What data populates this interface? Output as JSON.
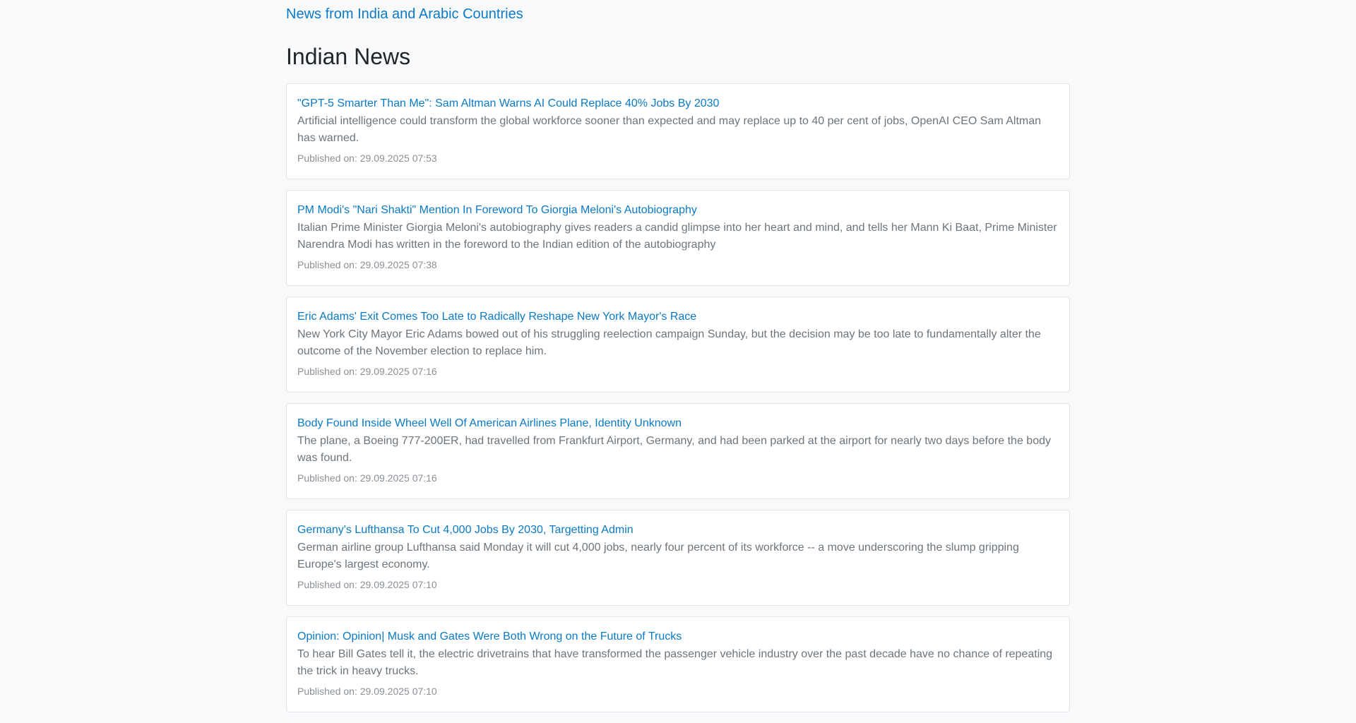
{
  "header": {
    "site_link": "News from India and Arabic Countries",
    "heading": "Indian News"
  },
  "articles": [
    {
      "title": "\"GPT-5 Smarter Than Me\": Sam Altman Warns AI Could Replace 40% Jobs By 2030",
      "description": "Artificial intelligence could transform the global workforce sooner than expected and may replace up to 40 per cent of jobs, OpenAI CEO Sam Altman has warned.",
      "published": "Published on: 29.09.2025 07:53"
    },
    {
      "title": "PM Modi's \"Nari Shakti\" Mention In Foreword To Giorgia Meloni's Autobiography",
      "description": "Italian Prime Minister Giorgia Meloni's autobiography gives readers a candid glimpse into her heart and mind, and tells her Mann Ki Baat, Prime Minister Narendra Modi has written in the foreword to the Indian edition of the autobiography",
      "published": "Published on: 29.09.2025 07:38"
    },
    {
      "title": "Eric Adams' Exit Comes Too Late to Radically Reshape New York Mayor's Race",
      "description": "New York City Mayor Eric Adams bowed out of his struggling reelection campaign Sunday, but the decision may be too late to fundamentally alter the outcome of the November election to replace him.",
      "published": "Published on: 29.09.2025 07:16"
    },
    {
      "title": "Body Found Inside Wheel Well Of American Airlines Plane, Identity Unknown",
      "description": "The plane, a Boeing 777-200ER, had travelled from Frankfurt Airport, Germany, and had been parked at the airport for nearly two days before the body was found.",
      "published": "Published on: 29.09.2025 07:16"
    },
    {
      "title": "Germany's Lufthansa To Cut 4,000 Jobs By 2030, Targetting Admin",
      "description": "German airline group Lufthansa said Monday it will cut 4,000 jobs, nearly four percent of its workforce -- a move underscoring the slump gripping Europe's largest economy.",
      "published": "Published on: 29.09.2025 07:10"
    },
    {
      "title": "Opinion: Opinion| Musk and Gates Were Both Wrong on the Future of Trucks",
      "description": "To hear Bill Gates tell it, the electric drivetrains that have transformed the passenger vehicle industry over the past decade have no chance of repeating the trick in heavy trucks.",
      "published": "Published on: 29.09.2025 07:10"
    }
  ]
}
